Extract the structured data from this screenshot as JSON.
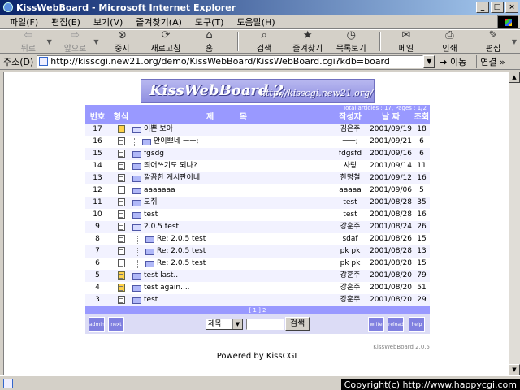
{
  "window": {
    "title": "KissWebBoard - Microsoft Internet Explorer",
    "minimize": "_",
    "maximize": "□",
    "close": "×"
  },
  "menu": [
    "파일(F)",
    "편집(E)",
    "보기(V)",
    "즐겨찾기(A)",
    "도구(T)",
    "도움말(H)"
  ],
  "toolbar": {
    "back": "뒤로",
    "forward": "앞으로",
    "stop": "중지",
    "refresh": "새로고침",
    "home": "홈",
    "search": "검색",
    "favorites": "즐겨찾기",
    "history": "목록보기",
    "mail": "메일",
    "print": "인쇄",
    "edit": "편집"
  },
  "address": {
    "label": "주소(D)",
    "url": "http://kisscgi.new21.org/demo/KissWebBoard/KissWebBoard.cgi?kdb=board",
    "go": "이동",
    "links": "연결 »"
  },
  "board": {
    "logo_main": "KissWebBoard 2",
    "logo_url": "http://kisscgi.new21.org/",
    "stats": "Total articles : 17, Pages : 1/2",
    "headers": {
      "no": "번호",
      "form": "형식",
      "subject": "제 목",
      "author": "작성자",
      "date": "날 짜",
      "hits": "조회"
    },
    "rows": [
      {
        "no": "17",
        "subject": "이쁜 보아",
        "author": "김은주",
        "date": "2001/09/19",
        "hits": "18"
      },
      {
        "no": "16",
        "subject": "안이쁘네 ㅡㅡ;",
        "author": "ㅡㅡ;",
        "date": "2001/09/21",
        "hits": "6"
      },
      {
        "no": "15",
        "subject": "fgsdg",
        "author": "fdgsfd",
        "date": "2001/09/16",
        "hits": "6"
      },
      {
        "no": "14",
        "subject": "띄어쓰기도 되나?",
        "author": "사랑",
        "date": "2001/09/14",
        "hits": "11"
      },
      {
        "no": "13",
        "subject": "깔끔한 게시판이네",
        "author": "한명철",
        "date": "2001/09/12",
        "hits": "16"
      },
      {
        "no": "12",
        "subject": "aaaaaaa",
        "author": "aaaaa",
        "date": "2001/09/06",
        "hits": "5"
      },
      {
        "no": "11",
        "subject": "모쥐",
        "author": "test",
        "date": "2001/08/28",
        "hits": "35"
      },
      {
        "no": "10",
        "subject": "test",
        "author": "test",
        "date": "2001/08/28",
        "hits": "16"
      },
      {
        "no": "9",
        "subject": "2.0.5 test",
        "author": "강훈주",
        "date": "2001/08/24",
        "hits": "26"
      },
      {
        "no": "8",
        "subject": "Re: 2.0.5 test",
        "author": "sdaf",
        "date": "2001/08/26",
        "hits": "15"
      },
      {
        "no": "7",
        "subject": "Re: 2.0.5 test",
        "author": "pk pk",
        "date": "2001/08/28",
        "hits": "13"
      },
      {
        "no": "6",
        "subject": "Re: 2.0.5 test",
        "author": "pk pk",
        "date": "2001/08/28",
        "hits": "15"
      },
      {
        "no": "5",
        "subject": "test last..",
        "author": "강훈주",
        "date": "2001/08/20",
        "hits": "79"
      },
      {
        "no": "4",
        "subject": "test again....",
        "author": "강훈주",
        "date": "2001/08/20",
        "hits": "51"
      },
      {
        "no": "3",
        "subject": "test",
        "author": "강훈주",
        "date": "2001/08/20",
        "hits": "29"
      }
    ],
    "pager": "[ 1 ] 2",
    "buttons": {
      "admin": "admin",
      "next": "next",
      "write": "write",
      "reload": "reload",
      "help": "help"
    },
    "search_select": "제목",
    "search_button": "검색",
    "version": "KissWebBoard 2.0.5",
    "powered": "Powered by KissCGI"
  },
  "status": {
    "copyright": "Copyright(c) http://www.happycgi.com"
  }
}
